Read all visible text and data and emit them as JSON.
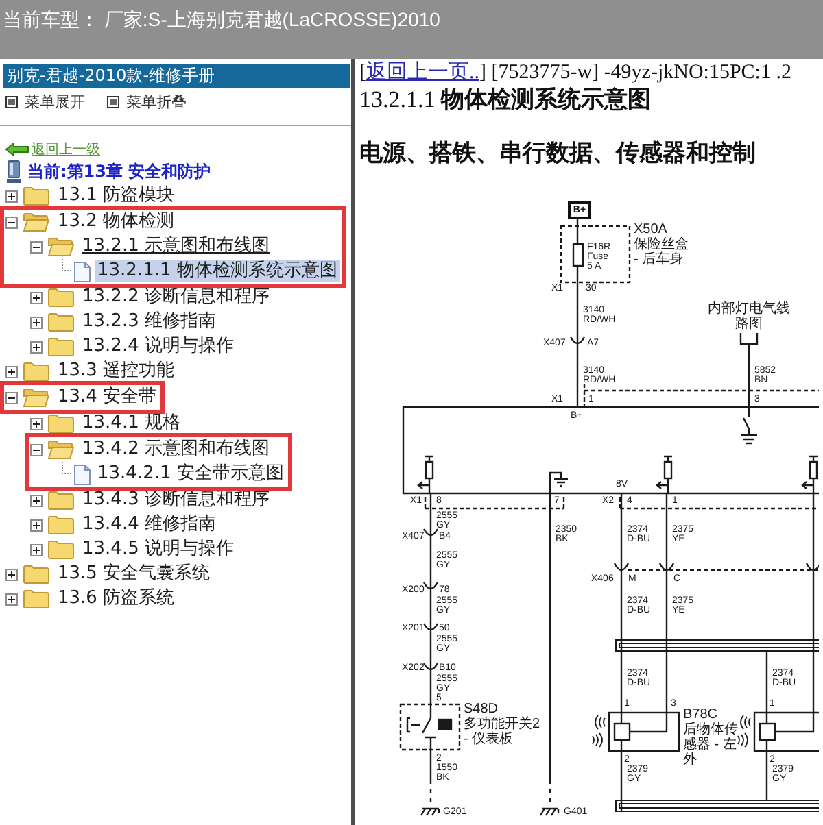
{
  "vehicle_bar": {
    "text": "当前车型： 厂家:S-上海别克君越(LaCROSSE)2010"
  },
  "sidebar": {
    "manual_title": "别克-君越-2010款-维修手册",
    "menu_actions": [
      "菜单展开",
      "菜单折叠"
    ],
    "back_link": "返回上一级",
    "current_chapter": "当前:第13章 安全和防护"
  },
  "tree": [
    {
      "label": "13.1 防盗模块",
      "kind": "folder",
      "expanded": false,
      "selected": false,
      "hovered": false,
      "framed": false
    },
    {
      "label": "13.2 物体检测",
      "kind": "folder",
      "expanded": true,
      "selected": false,
      "hovered": false,
      "framed": true,
      "children": [
        {
          "label": "13.2.1 示意图和布线图",
          "kind": "folder",
          "expanded": true,
          "selected": false,
          "hovered": true,
          "framed": true,
          "children": [
            {
              "label": "13.2.1.1 物体检测系统示意图",
              "kind": "page",
              "selected": true,
              "hovered": false,
              "framed": true
            }
          ]
        },
        {
          "label": "13.2.2 诊断信息和程序",
          "kind": "folder",
          "expanded": false,
          "selected": false,
          "hovered": false,
          "framed": false
        },
        {
          "label": "13.2.3 维修指南",
          "kind": "folder",
          "expanded": false,
          "selected": false,
          "hovered": false,
          "framed": false
        },
        {
          "label": "13.2.4 说明与操作",
          "kind": "folder",
          "expanded": false,
          "selected": false,
          "hovered": false,
          "framed": false
        }
      ]
    },
    {
      "label": "13.3 遥控功能",
      "kind": "folder",
      "expanded": false,
      "selected": false,
      "hovered": false,
      "framed": false
    },
    {
      "label": "13.4 安全带",
      "kind": "folder",
      "expanded": true,
      "selected": false,
      "hovered": false,
      "framed": true,
      "children": [
        {
          "label": "13.4.1 规格",
          "kind": "folder",
          "expanded": false,
          "selected": false,
          "hovered": false,
          "framed": false
        },
        {
          "label": "13.4.2 示意图和布线图",
          "kind": "folder",
          "expanded": true,
          "selected": false,
          "hovered": false,
          "framed": true,
          "children": [
            {
              "label": "13.4.2.1 安全带示意图",
              "kind": "page",
              "selected": false,
              "hovered": false,
              "framed": true
            }
          ]
        },
        {
          "label": "13.4.3 诊断信息和程序",
          "kind": "folder",
          "expanded": false,
          "selected": false,
          "hovered": false,
          "framed": false
        },
        {
          "label": "13.4.4 维修指南",
          "kind": "folder",
          "expanded": false,
          "selected": false,
          "hovered": false,
          "framed": false
        },
        {
          "label": "13.4.5 说明与操作",
          "kind": "folder",
          "expanded": false,
          "selected": false,
          "hovered": false,
          "framed": false
        }
      ]
    },
    {
      "label": "13.5 安全气囊系统",
      "kind": "folder",
      "expanded": false,
      "selected": false,
      "hovered": false,
      "framed": false
    },
    {
      "label": "13.6 防盗系统",
      "kind": "folder",
      "expanded": false,
      "selected": false,
      "hovered": false,
      "framed": false
    }
  ],
  "content": {
    "nav": {
      "before": "[",
      "back_link": "返回上一页..",
      "after": "] [7523775-w] -49yz-jkNO:15PC:1 .2"
    },
    "page_title": "13.2.1.1 **物体检测系统示意图**",
    "section_title": "电源、搭铁、串行数据、传感器和控制",
    "diagram": {
      "supply": "B+",
      "fuse_block": "X50A\n保险丝盒\n- 后车身",
      "fuse": "F16R\nFuse\n5 A",
      "reference": "内部灯电气线路图",
      "switch_label": "S48D\n多功能开关2\n- 仪表板",
      "sensor_label": "B78C\n后物体传感器 - 左外",
      "labels": [
        "X1",
        "30",
        "3140\nRD/WH",
        "X407",
        "A7",
        "3140\nRD/WH",
        "5852\nBN",
        "X1",
        "1",
        "3",
        "B+",
        "8V",
        "X1",
        "8",
        "7",
        "X2",
        "4",
        "1",
        "2555\nGY",
        "X407",
        "B4",
        "2350\nBK",
        "2374\nD-BU",
        "2375\nYE",
        "2555\nGY",
        "X406",
        "M",
        "C",
        "X200",
        "78",
        "2555\nGY",
        "2374\nD-BU",
        "2375\nYE",
        "X201",
        "50",
        "2555\nGY",
        "X202",
        "B10",
        "2555\nGY",
        "2374\nD-BU",
        "2374\nD-BU",
        "5",
        "1",
        "3",
        "1",
        "2",
        "2",
        "2",
        "1550\nBK",
        "2379\nGY",
        "2379\nGY",
        "G201",
        "G401"
      ]
    }
  }
}
